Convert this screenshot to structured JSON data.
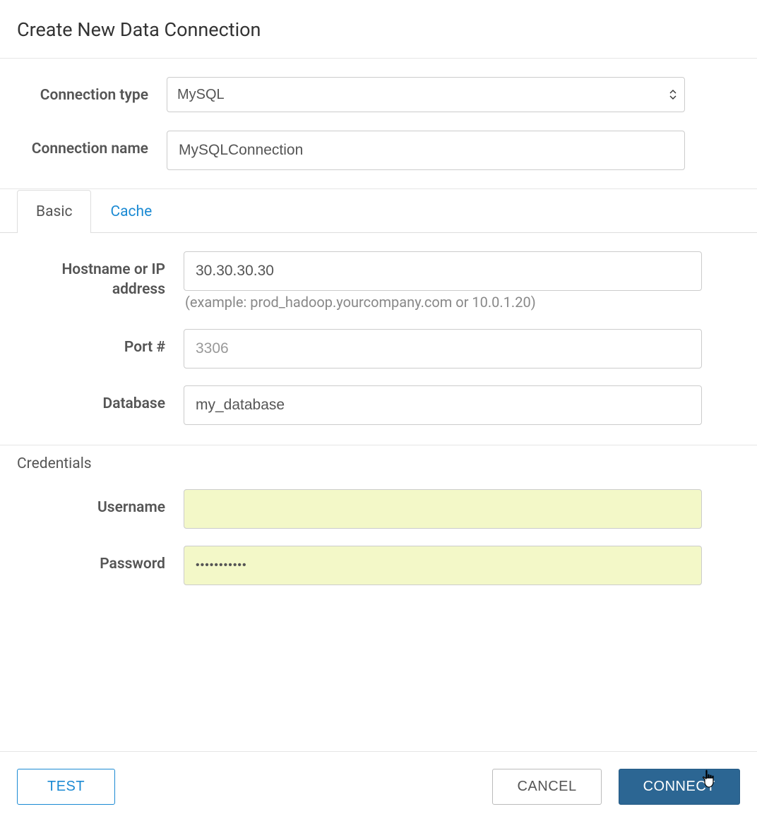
{
  "dialog": {
    "title": "Create New Data Connection"
  },
  "fields": {
    "connection_type": {
      "label": "Connection type",
      "value": "MySQL"
    },
    "connection_name": {
      "label": "Connection name",
      "value": "MySQLConnection"
    },
    "hostname": {
      "label": "Hostname or IP address",
      "value": "30.30.30.30",
      "help": "(example: prod_hadoop.yourcompany.com or 10.0.1.20)"
    },
    "port": {
      "label": "Port #",
      "value": "",
      "placeholder": "3306"
    },
    "database": {
      "label": "Database",
      "value": "my_database"
    },
    "username": {
      "label": "Username",
      "value": ""
    },
    "password": {
      "label": "Password",
      "value": "•••••••••••"
    }
  },
  "tabs": {
    "basic": "Basic",
    "cache": "Cache"
  },
  "sections": {
    "credentials": "Credentials"
  },
  "buttons": {
    "test": "TEST",
    "cancel": "CANCEL",
    "connect": "CONNECT"
  }
}
